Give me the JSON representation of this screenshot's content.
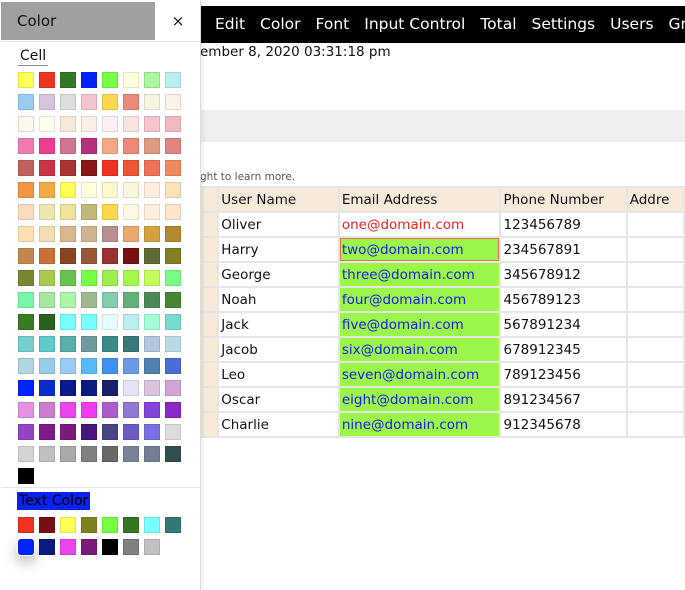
{
  "nav": {
    "items": [
      "Edit",
      "Color",
      "Font",
      "Input Control",
      "Total",
      "Settings",
      "Users",
      "Gr"
    ]
  },
  "date_text": "ember 8, 2020 03:31:18 pm",
  "hint_text": "ght to learn more.",
  "table": {
    "headers": [
      "User Name",
      "Email Address",
      "Phone Number",
      "Addre"
    ],
    "rows": [
      [
        "Oliver",
        "one@domain.com",
        "123456789"
      ],
      [
        "Harry",
        "two@domain.com",
        "234567891"
      ],
      [
        "George",
        "three@domain.com",
        "345678912"
      ],
      [
        "Noah",
        "four@domain.com",
        "456789123"
      ],
      [
        "Jack",
        "five@domain.com",
        "567891234"
      ],
      [
        "Jacob",
        "six@domain.com",
        "678912345"
      ],
      [
        "Leo",
        "seven@domain.com",
        "789123456"
      ],
      [
        "Oscar",
        "eight@domain.com",
        "891234567"
      ],
      [
        "Charlie",
        "nine@domain.com",
        "912345678"
      ]
    ],
    "email_fill_color": "#9cf64a",
    "email_text_color": "#1a1aee"
  },
  "panel": {
    "title": "Color",
    "close_label": "×",
    "cell_label": "Cell",
    "text_color_label": "Text Color",
    "cell_colors": [
      "#ffff55",
      "#ee3322",
      "#337722",
      "#0022ff",
      "#77ff44",
      "#ffffdd",
      "#aaf7a0",
      "#bbeeee",
      "#99ccf5",
      "#d8c4dd",
      "#dddddd",
      "#f6c4cc",
      "#fbd84d",
      "#ee8877",
      "#f4f4e0",
      "#fcf2e6",
      "#fdf7ee",
      "#fffff0",
      "#f8eadb",
      "#f8efe6",
      "#fcf0f4",
      "#f9e4e0",
      "#f6c4cc",
      "#f4b8c0",
      "#f07ab4",
      "#ee3d8f",
      "#d07494",
      "#b8307d",
      "#f3a884",
      "#ee8877",
      "#e09a80",
      "#e08484",
      "#c06060",
      "#cc3344",
      "#aa3333",
      "#881818",
      "#ee3322",
      "#ee5533",
      "#ee7055",
      "#f08860",
      "#f29440",
      "#f4aa44",
      "#ffff55",
      "#ffffdd",
      "#fff8cc",
      "#f8f8d8",
      "#fdeedd",
      "#fbe2b8",
      "#fbdcc0",
      "#eee6b0",
      "#eee498",
      "#c0b878",
      "#fbd84d",
      "#fff8e0",
      "#fdeedd",
      "#fde6cc",
      "#fce0b0",
      "#f4dcb4",
      "#d8b88c",
      "#d0b490",
      "#b89090",
      "#eaa870",
      "#d4a040",
      "#b48830",
      "#c08850",
      "#c87038",
      "#884420",
      "#985838",
      "#993333",
      "#771111",
      "#5a6a33",
      "#808020",
      "#778833",
      "#a8c850",
      "#66c44d",
      "#77ff44",
      "#99f04a",
      "#a4f84a",
      "#c4fc5a",
      "#77fc88",
      "#77f8a8",
      "#a4e8a0",
      "#acf4a8",
      "#9cb890",
      "#84ccac",
      "#64b078",
      "#4a8858",
      "#448832",
      "#3a7a22",
      "#2a6020",
      "#77ffff",
      "#77ffff",
      "#e4ffff",
      "#bbeeee",
      "#a4fcd8",
      "#77dcd0",
      "#77d0d0",
      "#5ccccc",
      "#58b0a8",
      "#6c9c9c",
      "#3a8888",
      "#387878",
      "#b4c4dc",
      "#b8dce4",
      "#b0d4e0",
      "#98cce8",
      "#98ccf4",
      "#55bbfa",
      "#4090f4",
      "#6c98e8",
      "#5080b0",
      "#4a6cd8",
      "#0022ff",
      "#0a2cc8",
      "#0a1a88",
      "#0a1a80",
      "#1a2070",
      "#e4e4f8",
      "#d8c4dc",
      "#d4a4d8",
      "#e490e4",
      "#cc7ccc",
      "#ee44ee",
      "#ee3cee",
      "#aa5ccc",
      "#9078d4",
      "#8444d8",
      "#8828c8",
      "#9044c4",
      "#801a88",
      "#7a1a7a",
      "#44187c",
      "#484484",
      "#6a5cc4",
      "#7a70e4",
      "#dddddd",
      "#d4d4d4",
      "#c0c0c0",
      "#a8a8a8",
      "#808080",
      "#686868",
      "#788494",
      "#708090",
      "#2f4f4f",
      "#000000"
    ],
    "text_colors": [
      "#ee3322",
      "#771111",
      "#ffff55",
      "#808020",
      "#77ff44",
      "#337722",
      "#77ffff",
      "#337777",
      "#0022ff",
      "#0a1a80",
      "#ee44ee",
      "#7a1a7a",
      "#000000",
      "#808080",
      "#c0c0c0"
    ],
    "selected_text_color": "#0022ff"
  }
}
